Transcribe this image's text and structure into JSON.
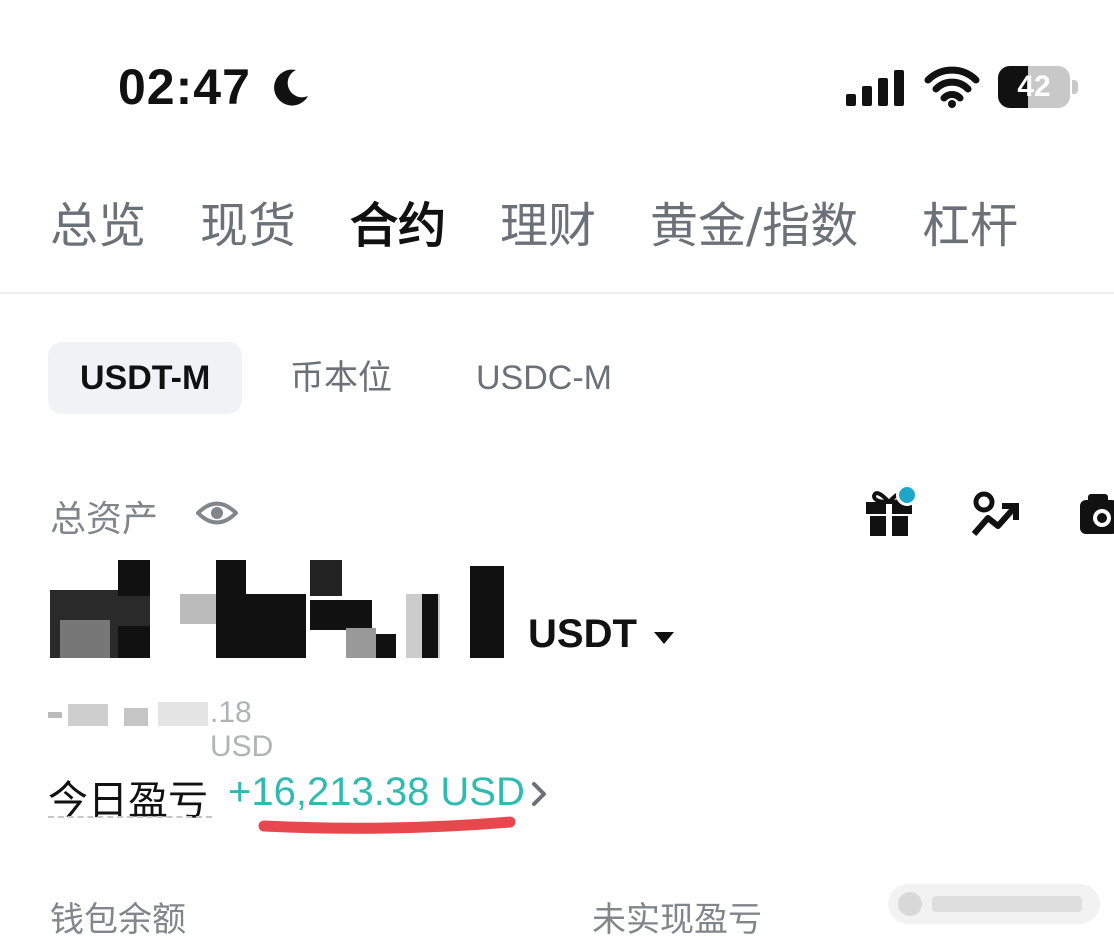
{
  "status_bar": {
    "time": "02:47",
    "battery": "42",
    "battery_level": 0.42,
    "icons": [
      "moon-icon",
      "signal-icon",
      "wifi-icon",
      "battery-icon"
    ]
  },
  "main_tabs": [
    {
      "label": "总览",
      "active": false
    },
    {
      "label": "现货",
      "active": false
    },
    {
      "label": "合约",
      "active": true
    },
    {
      "label": "理财",
      "active": false
    },
    {
      "label": "黄金/指数",
      "active": false
    },
    {
      "label": "杠杆",
      "active": false
    }
  ],
  "sub_tabs": [
    {
      "label": "USDT-M",
      "active": true
    },
    {
      "label": "币本位",
      "active": false
    },
    {
      "label": "USDC-M",
      "active": false
    }
  ],
  "assets": {
    "label": "总资产",
    "unit": "USDT",
    "approx_value": ".18 USD",
    "action_icons": [
      "gift-icon",
      "referral-icon",
      "camera-icon"
    ]
  },
  "pnl": {
    "label": "今日盈亏",
    "value": "+16,213.38 USD"
  },
  "bottom": {
    "wallet_label": "钱包余额",
    "unrealized_label": "未实现盈亏"
  },
  "colors": {
    "accent_positive": "#2ebbb0",
    "highlight_mark": "#e8474e",
    "notification_dot": "#1fa7c9",
    "text_primary": "#111111",
    "text_secondary": "#81858c"
  }
}
